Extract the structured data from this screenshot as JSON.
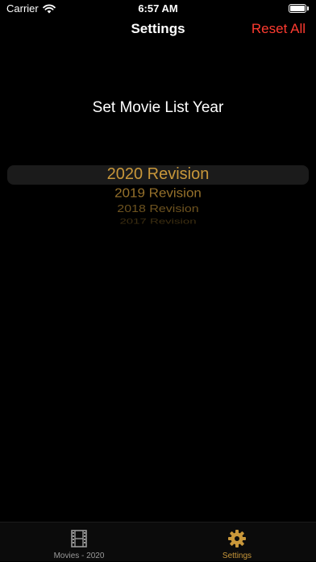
{
  "status_bar": {
    "carrier": "Carrier",
    "time": "6:57 AM",
    "wifi_icon": "wifi-icon",
    "battery_icon": "battery-icon"
  },
  "nav": {
    "title": "Settings",
    "reset_label": "Reset All"
  },
  "settings": {
    "section_label": "Set Movie List Year",
    "picker": {
      "selected": "2020 Revision",
      "options": [
        "2020 Revision",
        "2019 Revision",
        "2018 Revision",
        "2017 Revision"
      ]
    }
  },
  "tab_bar": {
    "tabs": [
      {
        "label": "Movies - 2020",
        "icon": "film-icon",
        "active": false
      },
      {
        "label": "Settings",
        "icon": "gear-icon",
        "active": true
      }
    ]
  },
  "colors": {
    "background": "#000000",
    "accent": "#c8973a",
    "destructive": "#ff3b30",
    "inactive_tab": "#9a9a9a"
  }
}
